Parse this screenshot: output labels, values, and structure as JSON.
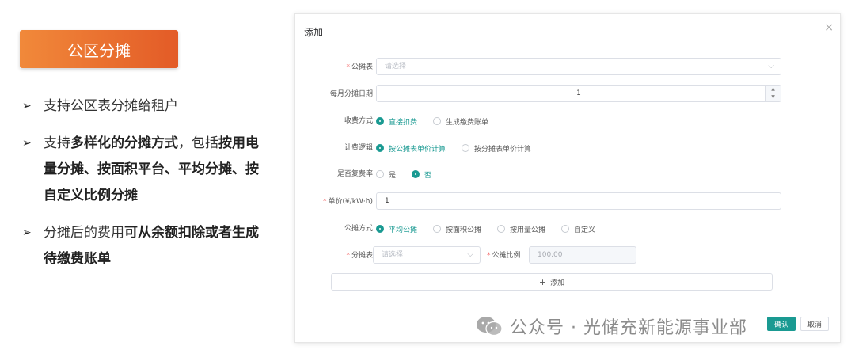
{
  "slide": {
    "title": "公区分摊",
    "bullets": [
      [
        {
          "t": "支持公区表分摊给租户",
          "b": false
        }
      ],
      [
        {
          "t": "支持",
          "b": false
        },
        {
          "t": "多样化的分摊方式",
          "b": true
        },
        {
          "t": "，包括",
          "b": false
        },
        {
          "t": "按用电量分摊、按面积平台、平均分摊、按自定义比例分摊",
          "b": true
        }
      ],
      [
        {
          "t": "分摊后的费用",
          "b": false
        },
        {
          "t": "可从余额扣除或者生成待缴费账单",
          "b": true
        }
      ]
    ]
  },
  "dialog": {
    "title": "添加",
    "close": "×",
    "fields": {
      "meter_label": "公摊表",
      "meter_placeholder": "请选择",
      "date_label": "每月分摊日期",
      "date_value": "1",
      "charge_label": "收费方式",
      "charge_options": [
        "直接扣费",
        "生成缴费账单"
      ],
      "logic_label": "计费逻辑",
      "logic_options": [
        "按公摊表单价计算",
        "按分摊表单价计算"
      ],
      "rate_label": "是否复费率",
      "rate_options": [
        "是",
        "否"
      ],
      "price_label": "单价(¥/kW·h)",
      "price_value": "1",
      "method_label": "公摊方式",
      "method_options": [
        "平均公摊",
        "按面积公摊",
        "按用量公摊",
        "自定义"
      ],
      "sub_meter_label": "分摊表",
      "sub_meter_placeholder": "请选择",
      "ratio_label": "公摊比例",
      "ratio_value": "100.00"
    },
    "add_button": "添加",
    "confirm": "确认",
    "cancel": "取消"
  },
  "watermark": "公众号 · 光储充新能源事业部",
  "colors": {
    "accent": "#1a9a92",
    "title_gradient_start": "#f1893a",
    "title_gradient_end": "#e35b27",
    "required": "#f56c6c"
  },
  "icons": {
    "close": "close-icon",
    "chevron": "chevron-down-icon",
    "plus": "plus-icon",
    "wechat": "wechat-icon"
  }
}
